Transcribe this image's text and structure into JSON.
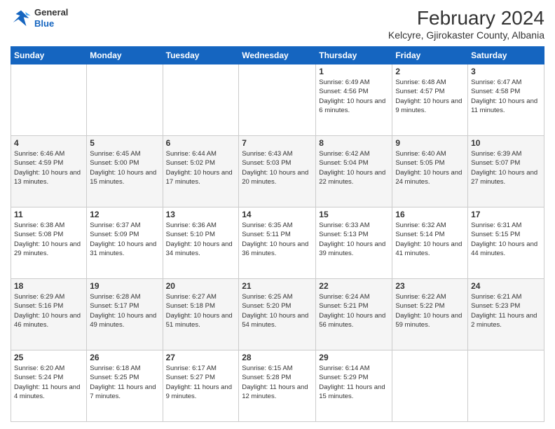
{
  "header": {
    "logo": {
      "line1": "General",
      "line2": "Blue"
    },
    "title": "February 2024",
    "location": "Kelcyre, Gjirokaster County, Albania"
  },
  "weekdays": [
    "Sunday",
    "Monday",
    "Tuesday",
    "Wednesday",
    "Thursday",
    "Friday",
    "Saturday"
  ],
  "weeks": [
    [
      null,
      null,
      null,
      null,
      {
        "day": "1",
        "sunrise": "6:49 AM",
        "sunset": "4:56 PM",
        "daylight": "10 hours and 6 minutes."
      },
      {
        "day": "2",
        "sunrise": "6:48 AM",
        "sunset": "4:57 PM",
        "daylight": "10 hours and 9 minutes."
      },
      {
        "day": "3",
        "sunrise": "6:47 AM",
        "sunset": "4:58 PM",
        "daylight": "10 hours and 11 minutes."
      }
    ],
    [
      {
        "day": "4",
        "sunrise": "6:46 AM",
        "sunset": "4:59 PM",
        "daylight": "10 hours and 13 minutes."
      },
      {
        "day": "5",
        "sunrise": "6:45 AM",
        "sunset": "5:00 PM",
        "daylight": "10 hours and 15 minutes."
      },
      {
        "day": "6",
        "sunrise": "6:44 AM",
        "sunset": "5:02 PM",
        "daylight": "10 hours and 17 minutes."
      },
      {
        "day": "7",
        "sunrise": "6:43 AM",
        "sunset": "5:03 PM",
        "daylight": "10 hours and 20 minutes."
      },
      {
        "day": "8",
        "sunrise": "6:42 AM",
        "sunset": "5:04 PM",
        "daylight": "10 hours and 22 minutes."
      },
      {
        "day": "9",
        "sunrise": "6:40 AM",
        "sunset": "5:05 PM",
        "daylight": "10 hours and 24 minutes."
      },
      {
        "day": "10",
        "sunrise": "6:39 AM",
        "sunset": "5:07 PM",
        "daylight": "10 hours and 27 minutes."
      }
    ],
    [
      {
        "day": "11",
        "sunrise": "6:38 AM",
        "sunset": "5:08 PM",
        "daylight": "10 hours and 29 minutes."
      },
      {
        "day": "12",
        "sunrise": "6:37 AM",
        "sunset": "5:09 PM",
        "daylight": "10 hours and 31 minutes."
      },
      {
        "day": "13",
        "sunrise": "6:36 AM",
        "sunset": "5:10 PM",
        "daylight": "10 hours and 34 minutes."
      },
      {
        "day": "14",
        "sunrise": "6:35 AM",
        "sunset": "5:11 PM",
        "daylight": "10 hours and 36 minutes."
      },
      {
        "day": "15",
        "sunrise": "6:33 AM",
        "sunset": "5:13 PM",
        "daylight": "10 hours and 39 minutes."
      },
      {
        "day": "16",
        "sunrise": "6:32 AM",
        "sunset": "5:14 PM",
        "daylight": "10 hours and 41 minutes."
      },
      {
        "day": "17",
        "sunrise": "6:31 AM",
        "sunset": "5:15 PM",
        "daylight": "10 hours and 44 minutes."
      }
    ],
    [
      {
        "day": "18",
        "sunrise": "6:29 AM",
        "sunset": "5:16 PM",
        "daylight": "10 hours and 46 minutes."
      },
      {
        "day": "19",
        "sunrise": "6:28 AM",
        "sunset": "5:17 PM",
        "daylight": "10 hours and 49 minutes."
      },
      {
        "day": "20",
        "sunrise": "6:27 AM",
        "sunset": "5:18 PM",
        "daylight": "10 hours and 51 minutes."
      },
      {
        "day": "21",
        "sunrise": "6:25 AM",
        "sunset": "5:20 PM",
        "daylight": "10 hours and 54 minutes."
      },
      {
        "day": "22",
        "sunrise": "6:24 AM",
        "sunset": "5:21 PM",
        "daylight": "10 hours and 56 minutes."
      },
      {
        "day": "23",
        "sunrise": "6:22 AM",
        "sunset": "5:22 PM",
        "daylight": "10 hours and 59 minutes."
      },
      {
        "day": "24",
        "sunrise": "6:21 AM",
        "sunset": "5:23 PM",
        "daylight": "11 hours and 2 minutes."
      }
    ],
    [
      {
        "day": "25",
        "sunrise": "6:20 AM",
        "sunset": "5:24 PM",
        "daylight": "11 hours and 4 minutes."
      },
      {
        "day": "26",
        "sunrise": "6:18 AM",
        "sunset": "5:25 PM",
        "daylight": "11 hours and 7 minutes."
      },
      {
        "day": "27",
        "sunrise": "6:17 AM",
        "sunset": "5:27 PM",
        "daylight": "11 hours and 9 minutes."
      },
      {
        "day": "28",
        "sunrise": "6:15 AM",
        "sunset": "5:28 PM",
        "daylight": "11 hours and 12 minutes."
      },
      {
        "day": "29",
        "sunrise": "6:14 AM",
        "sunset": "5:29 PM",
        "daylight": "11 hours and 15 minutes."
      },
      null,
      null
    ]
  ]
}
